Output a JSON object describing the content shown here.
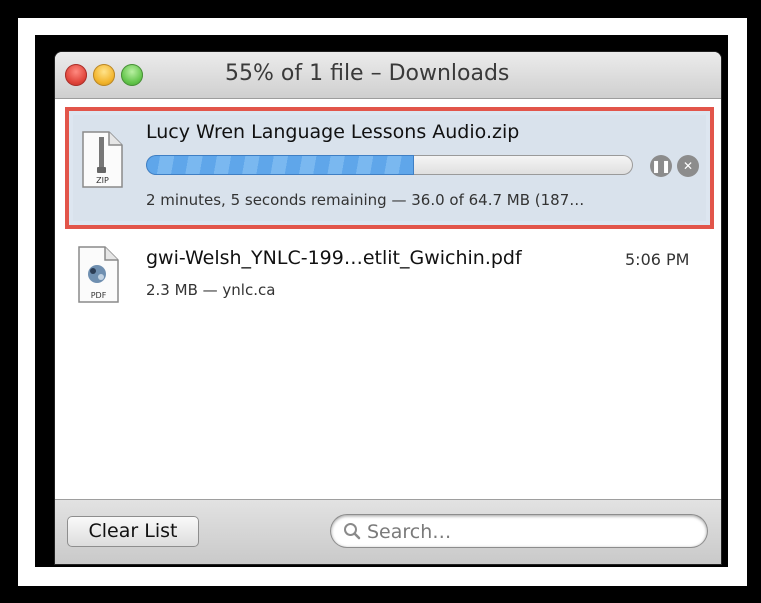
{
  "window": {
    "title": "55% of 1 file – Downloads"
  },
  "downloads": [
    {
      "name": "Lucy Wren Language Lessons Audio.zip",
      "file_type_label": "ZIP",
      "status": "2 minutes, 5 seconds remaining — 36.0 of 64.7 MB (187…",
      "progress_fraction": 0.55,
      "pause_icon": "pause-icon",
      "cancel_icon": "cancel-icon"
    },
    {
      "name": "gwi-Welsh_YNLC-199…etlit_Gwichin.pdf",
      "file_type_label": "PDF",
      "status": "2.3 MB — ynlc.ca",
      "time": "5:06 PM"
    }
  ],
  "footer": {
    "clear_label": "Clear List",
    "search_placeholder": "Search…"
  },
  "colors": {
    "highlight_border": "#e2554a",
    "progress_fill": "#5fa6ea"
  }
}
